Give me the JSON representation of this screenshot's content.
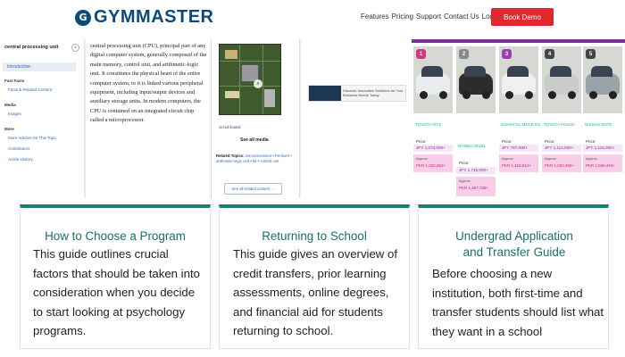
{
  "nav": {
    "logo_mark": "G",
    "logo_text": "GYMMASTER",
    "links": [
      "Features",
      "Pricing",
      "Support",
      "Contact Us",
      "Login"
    ],
    "cta": "Book Demo",
    "cta_color": "#e0282f"
  },
  "wiki_sidebar": {
    "title": "central processing unit",
    "close": "×",
    "intro": "Introduction",
    "sections": [
      {
        "heading": "Fast Facts",
        "links": [
          "Facts & Related Content"
        ]
      },
      {
        "heading": "Media",
        "links": [
          "Images"
        ]
      },
      {
        "heading": "More",
        "links": [
          "More Articles On This Topic",
          "Contributors",
          "Article History"
        ]
      }
    ]
  },
  "wiki_article": {
    "text": "central processing unit (CPU), principal part of any digital computer system, generally composed of the main memory, control unit, and arithmetic-logic unit. It constitutes the physical heart of the entire computer system; to it is linked various peripheral equipment, including input/output devices and auxiliary storage units. In modern computers, the CPU is contained on an integrated circuit chip called a microprocessor."
  },
  "image_panel": {
    "caption": "circuit board",
    "see_all": "See all media",
    "related_label": "Related Topics:",
    "related_topics": "microprocessor • Pentium • arithmetic-logic unit • bit • control unit",
    "related_button": "See all related content →"
  },
  "ad": {
    "text": "Discover Innovative Solutions for Your Business Needs Today"
  },
  "cars": [
    {
      "badge": "1",
      "badge_color": "#d63384",
      "name": "TOYOTA VITZ",
      "price_label": "Price:",
      "price": "JPY 1,073,000+",
      "approx_label": "Approx",
      "approx": "PKR 1,332,962+",
      "body_color": "#e8ecef"
    },
    {
      "badge": "2",
      "badge_color": "#888888",
      "name": "HONDA VEZEL",
      "price_label": "Price:",
      "price": "JPY 1,715,000+",
      "approx_label": "Approx",
      "approx": "PKR 1,467,728+",
      "body_color": "#2c2c2c"
    },
    {
      "badge": "3",
      "badge_color": "#9b3fb0",
      "name": "DAIHATSU MOVE ES",
      "price_label": "Price:",
      "price": "JPY 797,000+",
      "approx_label": "Approx",
      "approx": "PKR 1,118,614+",
      "body_color": "#f0f0f0"
    },
    {
      "badge": "4",
      "badge_color": "#444444",
      "name": "TOYOTA PASSO",
      "price_label": "Price:",
      "price": "JPY 1,114,000+",
      "approx_label": "Approx",
      "approx": "PKR 1,563,496+",
      "body_color": "#c9ccc8"
    },
    {
      "badge": "5",
      "badge_color": "#444444",
      "name": "NISSAN NOTE",
      "price_label": "Price:",
      "price": "JPY 1,115,000+",
      "approx_label": "Approx",
      "approx": "PKR 1,565,484+",
      "body_color": "#9aa3a8"
    }
  ],
  "cards": [
    {
      "title": "How to Choose a Program",
      "body": "This guide outlines crucial factors that should be taken into consideration when you decide to start looking at psychology programs."
    },
    {
      "title": "Returning to School",
      "body": "This guide gives an overview of credit transfers, prior learning assessments, online degrees, and financial aid for students returning to school."
    },
    {
      "title": "Undergrad Application and Transfer Guide",
      "body": "Before choosing a new institution, both first-time and transfer students should list what they want in a school"
    }
  ],
  "colors": {
    "card_accent": "#1d7f6d",
    "card_title": "#1a7065",
    "brand": "#0b4a7a",
    "link": "#3366cc"
  }
}
